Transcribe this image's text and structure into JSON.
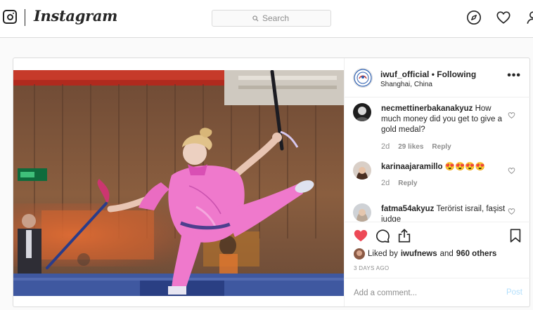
{
  "nav": {
    "logo_icon": "instagram-glyph-icon",
    "wordmark": "Instagram",
    "search_placeholder": "Search",
    "icons": [
      "explore-compass-icon",
      "activity-heart-icon",
      "profile-icon"
    ]
  },
  "post": {
    "account": "iwuf_official",
    "separator": "•",
    "follow_status": "Following",
    "location": "Shanghai, China",
    "options_label": "•••",
    "comments": [
      {
        "username": "necmettinerbakanakyuz",
        "text": "How much money did you get to give a gold medal?",
        "age": "2d",
        "likes": "29 likes",
        "reply": "Reply"
      },
      {
        "username": "karinaajaramillo",
        "text": "😍😍😍😍",
        "age": "2d",
        "reply": "Reply"
      },
      {
        "username": "fatma54akyuz",
        "text": "Terörist israil, faşist iudge"
      }
    ],
    "liked_prefix": "Liked by",
    "liked_user": "iwufnews",
    "liked_and": "and",
    "liked_others": "960 others",
    "time_ago": "3 DAYS AGO",
    "comment_placeholder": "Add a comment...",
    "post_button": "Post"
  },
  "colors": {
    "like_red": "#ed4956",
    "post_button_disabled": "#b2dffc",
    "border": "#dbdbdb",
    "muted": "#8e8e8e"
  }
}
